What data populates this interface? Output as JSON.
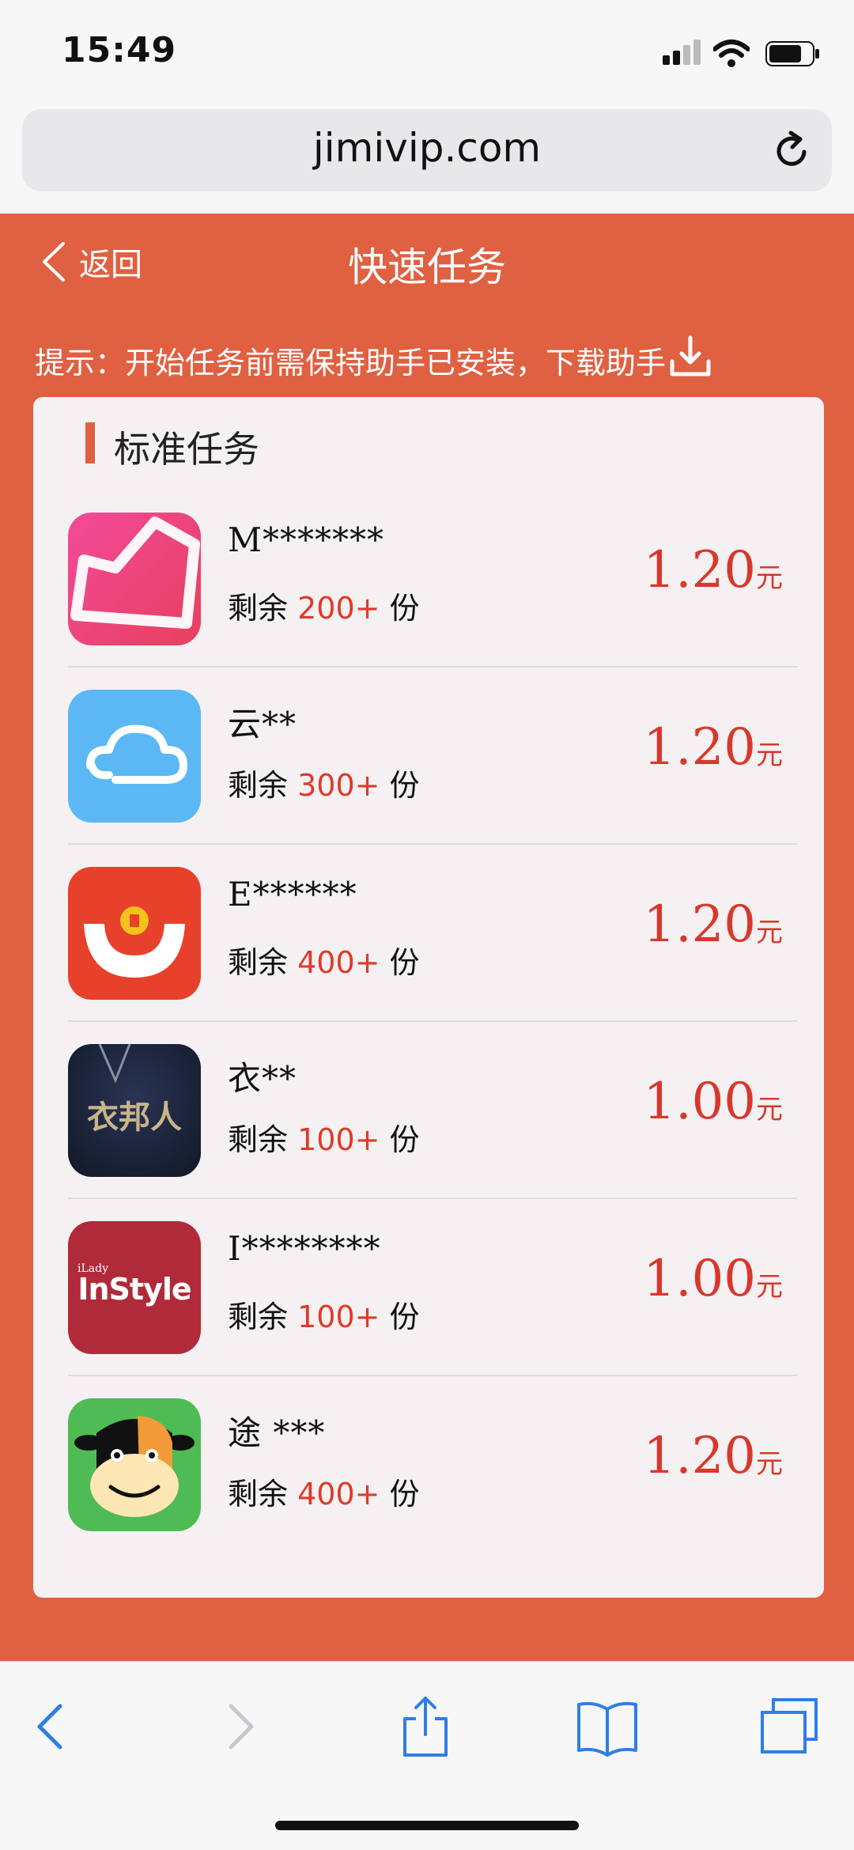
{
  "status_bar": {
    "time": "15:49"
  },
  "browser": {
    "url": "jimivip.com"
  },
  "header": {
    "back_label": "返回",
    "title": "快速任务"
  },
  "tip": {
    "text": "提示：开始任务前需保持助手已安装，下载助手"
  },
  "section": {
    "title": "标准任务"
  },
  "tasks": [
    {
      "name": "M*******",
      "remain_prefix": "剩余 ",
      "remain_count": "200+",
      "remain_suffix": " 份",
      "price": "1.20",
      "unit": "元",
      "icon": "star-app-icon"
    },
    {
      "name": "云**",
      "remain_prefix": "剩余 ",
      "remain_count": "300+",
      "remain_suffix": " 份",
      "price": "1.20",
      "unit": "元",
      "icon": "cloud-app-icon"
    },
    {
      "name": "E******",
      "remain_prefix": "剩余 ",
      "remain_count": "400+",
      "remain_suffix": " 份",
      "price": "1.20",
      "unit": "元",
      "icon": "smile-coin-app-icon"
    },
    {
      "name": "衣**",
      "remain_prefix": "剩余 ",
      "remain_count": "100+",
      "remain_suffix": " 份",
      "price": "1.00",
      "unit": "元",
      "icon": "yibangren-app-icon",
      "icon_text": "衣邦人"
    },
    {
      "name": "I********",
      "remain_prefix": "剩余 ",
      "remain_count": "100+",
      "remain_suffix": " 份",
      "price": "1.00",
      "unit": "元",
      "icon": "instyle-app-icon",
      "icon_text": "InStyle",
      "icon_small_text": "iLady"
    },
    {
      "name": "途 ***",
      "remain_prefix": "剩余 ",
      "remain_count": "400+",
      "remain_suffix": " 份",
      "price": "1.20",
      "unit": "元",
      "icon": "cow-app-icon"
    }
  ]
}
